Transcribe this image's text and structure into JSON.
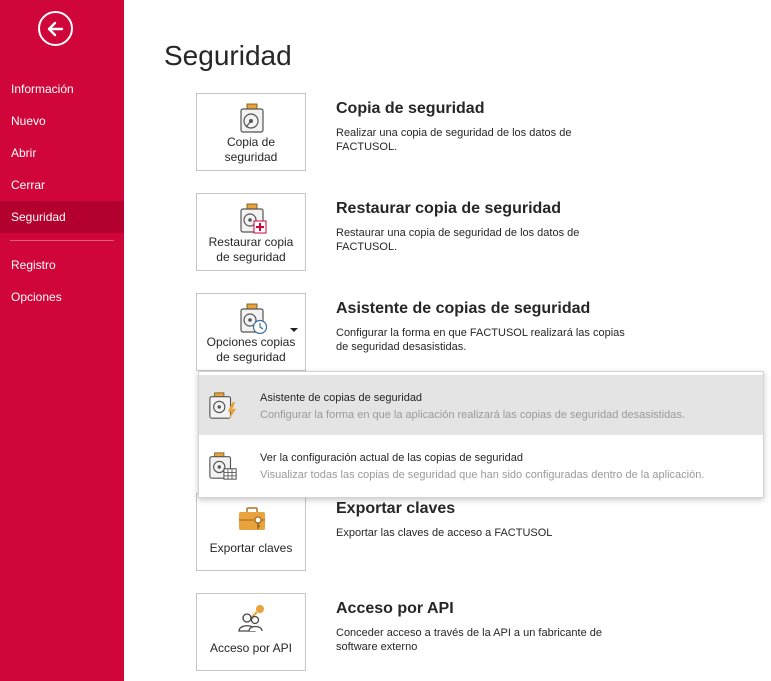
{
  "sidebar": {
    "items": [
      {
        "label": "Información"
      },
      {
        "label": "Nuevo"
      },
      {
        "label": "Abrir"
      },
      {
        "label": "Cerrar"
      },
      {
        "label": "Seguridad"
      },
      {
        "label": "Registro"
      },
      {
        "label": "Opciones"
      }
    ]
  },
  "page": {
    "title": "Seguridad"
  },
  "sections": [
    {
      "tile_line1": "Copia de",
      "tile_line2": "seguridad",
      "title": "Copia de seguridad",
      "desc1": "Realizar una copia de seguridad de los datos de",
      "desc2": "FACTUSOL."
    },
    {
      "tile_line1": "Restaurar copia",
      "tile_line2": "de seguridad",
      "title": "Restaurar copia de seguridad",
      "desc1": "Restaurar una copia de seguridad de los datos de",
      "desc2": "FACTUSOL."
    },
    {
      "tile_line1": "Opciones copias",
      "tile_line2": "de seguridad",
      "title": "Asistente de copias de seguridad",
      "desc1": "Configurar la forma en que FACTUSOL realizará las copias",
      "desc2": "de seguridad desasistidas."
    },
    {
      "tile_line1": "Exportar claves",
      "title": "Exportar claves",
      "desc1": "Exportar las claves de acceso a FACTUSOL"
    },
    {
      "tile_line1": "Acceso por API",
      "title": "Acceso por API",
      "desc1": "Conceder acceso a través de la API a un fabricante de",
      "desc2": "software externo"
    }
  ],
  "dropdown": {
    "items": [
      {
        "title": "Asistente de copias de seguridad",
        "desc": "Configurar la forma en que la aplicación realizará las copias de seguridad desasistidas."
      },
      {
        "title": "Ver la configuración actual de las copias de seguridad",
        "desc": "Visualizar todas las copias de seguridad que han sido configuradas dentro de la aplicación."
      }
    ]
  },
  "colors": {
    "accent": "#d0053a",
    "accent_active": "#b3002f",
    "highlight": "#e4e4e4",
    "icon_orange": "#e8a33c"
  }
}
